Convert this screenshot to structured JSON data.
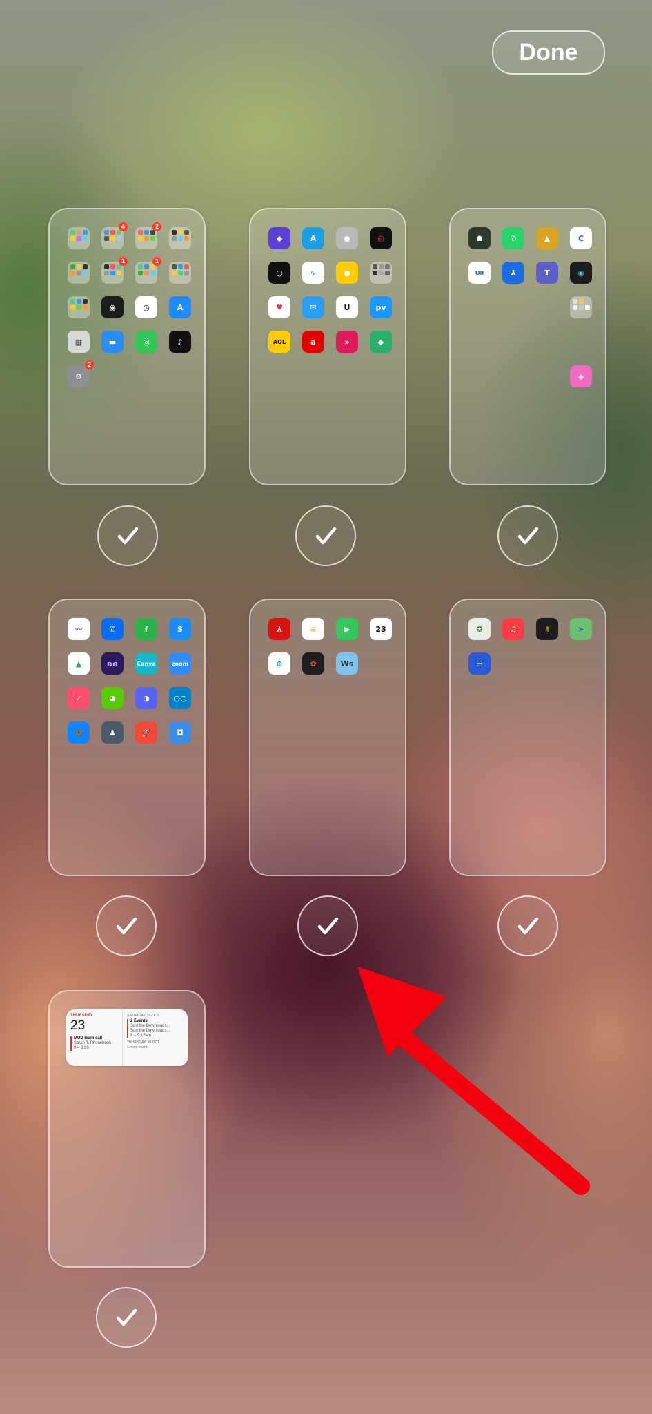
{
  "done_label": "Done",
  "colors": {
    "badge": "#ff3b30",
    "arrow": "#f5010e",
    "check": "#ffffff"
  },
  "pages": [
    {
      "name": "page-1",
      "selected": true,
      "icons": [
        {
          "name": "folder-1",
          "kind": "folder",
          "colors": [
            "#5c8",
            "#f93",
            "#39f",
            "#fc3",
            "#c6f",
            "#6cf"
          ]
        },
        {
          "name": "folder-2",
          "kind": "folder",
          "badge": "4",
          "colors": [
            "#39f",
            "#f55",
            "#6c6",
            "#555",
            "#fc3",
            "#9cf"
          ]
        },
        {
          "name": "folder-3",
          "kind": "folder",
          "badge": "2",
          "colors": [
            "#f66",
            "#39f",
            "#444",
            "#fc3",
            "#f93",
            "#6c6"
          ]
        },
        {
          "name": "folder-4",
          "kind": "folder",
          "colors": [
            "#333",
            "#fc3",
            "#555",
            "#999",
            "#6cf",
            "#f93"
          ]
        },
        {
          "name": "folder-5",
          "kind": "folder",
          "colors": [
            "#4a4",
            "#fc3",
            "#333",
            "#f93",
            "#999",
            "#6cf"
          ]
        },
        {
          "name": "folder-6",
          "kind": "folder",
          "badge": "1",
          "colors": [
            "#333",
            "#f55",
            "#5c8",
            "#999",
            "#39f",
            "#fc3"
          ]
        },
        {
          "name": "folder-7",
          "kind": "folder",
          "badge": "1",
          "colors": [
            "#5c8",
            "#39f",
            "#fc3",
            "#4a4",
            "#f93",
            "#6cf"
          ]
        },
        {
          "name": "folder-8",
          "kind": "folder",
          "colors": [
            "#555",
            "#39f",
            "#f55",
            "#fc3",
            "#5c8",
            "#999"
          ]
        },
        {
          "name": "folder-9",
          "kind": "folder",
          "colors": [
            "#5c8",
            "#39f",
            "#333",
            "#fc3",
            "#6c6",
            "#f93"
          ]
        },
        {
          "name": "watch-app",
          "kind": "app",
          "bg": "#1c1c1e",
          "glyph": "◉"
        },
        {
          "name": "clock-app",
          "kind": "app",
          "bg": "#ffffff",
          "fg": "#111",
          "glyph": "◷"
        },
        {
          "name": "app-store-app",
          "kind": "app",
          "bg": "#1d8cf8",
          "glyph": "A"
        },
        {
          "name": "calculator-app",
          "kind": "app",
          "bg": "#d8d8d8",
          "fg": "#333",
          "glyph": "▦"
        },
        {
          "name": "files-app",
          "kind": "app",
          "bg": "#2a8df5",
          "glyph": "▬"
        },
        {
          "name": "find-my-app",
          "kind": "app",
          "bg": "#33c759",
          "glyph": "◎"
        },
        {
          "name": "tiktok-app",
          "kind": "app",
          "bg": "#111111",
          "glyph": "♪"
        },
        {
          "name": "settings-app",
          "kind": "app",
          "bg": "#8e8e93",
          "glyph": "⚙",
          "badge": "2"
        }
      ]
    },
    {
      "name": "page-2",
      "selected": true,
      "icons": [
        {
          "name": "shortcuts-app",
          "kind": "app",
          "bg": "#5b3fd6",
          "glyph": "◆"
        },
        {
          "name": "translate-app",
          "kind": "app",
          "bg": "#1a9ee8",
          "glyph": "A"
        },
        {
          "name": "contacts-app",
          "kind": "app",
          "bg": "#b8b8b8",
          "glyph": "●"
        },
        {
          "name": "fitness-app",
          "kind": "app",
          "bg": "#111111",
          "fg": "#f33",
          "glyph": "◎"
        },
        {
          "name": "watch-faces-app",
          "kind": "app",
          "bg": "#111111",
          "glyph": "○"
        },
        {
          "name": "freeform-app",
          "kind": "app",
          "bg": "#ffffff",
          "fg": "#2a9df4",
          "glyph": "∿"
        },
        {
          "name": "tips-app",
          "kind": "app",
          "bg": "#ffcc00",
          "glyph": "●"
        },
        {
          "name": "utilities-folder",
          "kind": "folder",
          "colors": [
            "#555",
            "#999",
            "#777",
            "#333",
            "#aaa",
            "#666"
          ]
        },
        {
          "name": "health-app",
          "kind": "app",
          "bg": "#ffffff",
          "fg": "#ff2d55",
          "glyph": "♥"
        },
        {
          "name": "mail-app",
          "kind": "app",
          "bg": "#2a9df4",
          "glyph": "✉"
        },
        {
          "name": "udemy-app",
          "kind": "app",
          "bg": "#ffffff",
          "fg": "#111",
          "glyph": "U"
        },
        {
          "name": "prime-video-app",
          "kind": "app",
          "bg": "#1a98ff",
          "glyph": "pv"
        },
        {
          "name": "aol-app",
          "kind": "app",
          "bg": "#ffcc00",
          "fg": "#111",
          "glyph": "AOL"
        },
        {
          "name": "airtel-app",
          "kind": "app",
          "bg": "#e40000",
          "glyph": "a"
        },
        {
          "name": "kinemaster-app",
          "kind": "app",
          "bg": "#e0195a",
          "glyph": "»"
        },
        {
          "name": "feedly-app",
          "kind": "app",
          "bg": "#27b16b",
          "glyph": "◆"
        }
      ]
    },
    {
      "name": "page-3",
      "selected": true,
      "icons": [
        {
          "name": "game-app",
          "kind": "app",
          "bg": "#2b3a2a",
          "glyph": "☗"
        },
        {
          "name": "whatsapp-app",
          "kind": "app",
          "bg": "#25d366",
          "glyph": "✆"
        },
        {
          "name": "puzzle-game-app",
          "kind": "app",
          "bg": "#d9a520",
          "glyph": "▲"
        },
        {
          "name": "cc-app",
          "kind": "app",
          "bg": "#ffffff",
          "fg": "#1a6de0",
          "glyph": "C"
        },
        {
          "name": "otter-app",
          "kind": "app",
          "bg": "#ffffff",
          "fg": "#1a6de0",
          "glyph": "Oll"
        },
        {
          "name": "acrobat-app",
          "kind": "app",
          "bg": "#1a6de0",
          "glyph": "⅄"
        },
        {
          "name": "teams-app",
          "kind": "app",
          "bg": "#5b5fc7",
          "glyph": "T"
        },
        {
          "name": "eye-app",
          "kind": "app",
          "bg": "#1c1c1e",
          "fg": "#4cd",
          "glyph": "◉"
        },
        {
          "kind": "empty"
        },
        {
          "kind": "empty"
        },
        {
          "kind": "empty"
        },
        {
          "name": "folder-p3",
          "kind": "folder",
          "colors": [
            "#ddd",
            "#fc3",
            "#bbb",
            "#eee",
            "#ccc",
            "#fff"
          ]
        },
        {
          "kind": "empty"
        },
        {
          "kind": "empty"
        },
        {
          "kind": "empty"
        },
        {
          "kind": "empty"
        },
        {
          "kind": "empty"
        },
        {
          "kind": "empty"
        },
        {
          "kind": "empty"
        },
        {
          "name": "layers-app",
          "kind": "app",
          "bg": "#f06ac3",
          "glyph": "◈"
        }
      ]
    },
    {
      "name": "page-4",
      "selected": true,
      "icons": [
        {
          "name": "wave-app",
          "kind": "app",
          "bg": "#ffffff",
          "fg": "#7b5cf5",
          "glyph": "〰"
        },
        {
          "name": "truecaller-app",
          "kind": "app",
          "bg": "#0a6cf5",
          "glyph": "✆"
        },
        {
          "name": "feedly-green-app",
          "kind": "app",
          "bg": "#2bb24c",
          "glyph": "f"
        },
        {
          "name": "shazam-app",
          "kind": "app",
          "bg": "#1a8cf8",
          "glyph": "S"
        },
        {
          "name": "google-drive-app",
          "kind": "app",
          "bg": "#ffffff",
          "fg": "#1fa463",
          "glyph": "▲"
        },
        {
          "name": "butterfly-app",
          "kind": "app",
          "bg": "#2d1b5e",
          "fg": "#c9a6ff",
          "glyph": "ʚɞ"
        },
        {
          "name": "canva-app",
          "kind": "app",
          "bg": "#16b5c7",
          "glyph": "Canva"
        },
        {
          "name": "zoom-app",
          "kind": "app",
          "bg": "#2d8cff",
          "glyph": "zoom"
        },
        {
          "name": "tick-app",
          "kind": "app",
          "bg": "#ff4d6d",
          "glyph": "✓"
        },
        {
          "name": "duolingo-app",
          "kind": "app",
          "bg": "#58cc02",
          "glyph": "◕"
        },
        {
          "name": "discord-app",
          "kind": "app",
          "bg": "#5865f2",
          "glyph": "◑"
        },
        {
          "name": "nextcloud-app",
          "kind": "app",
          "bg": "#0082c9",
          "glyph": "○○"
        },
        {
          "name": "bluesky-app",
          "kind": "app",
          "bg": "#1185fe",
          "glyph": "🦋"
        },
        {
          "name": "pubg-app",
          "kind": "app",
          "bg": "#4a5a6a",
          "glyph": "♟"
        },
        {
          "name": "rocket-app",
          "kind": "app",
          "bg": "#f24a3a",
          "glyph": "🚀"
        },
        {
          "name": "robot-app",
          "kind": "app",
          "bg": "#3a8ee8",
          "glyph": "◘"
        }
      ]
    },
    {
      "name": "page-5",
      "selected": true,
      "icons": [
        {
          "name": "adobe-reader-app",
          "kind": "app",
          "bg": "#d7140f",
          "glyph": "⅄"
        },
        {
          "name": "notes-app",
          "kind": "app",
          "bg": "#ffffff",
          "fg": "#f5c400",
          "glyph": "≡"
        },
        {
          "name": "facetime-app",
          "kind": "app",
          "bg": "#34c759",
          "glyph": "▶"
        },
        {
          "name": "calendar-app",
          "kind": "app",
          "bg": "#ffffff",
          "fg": "#111",
          "glyph": "23",
          "top": "Thu"
        },
        {
          "name": "safari-app",
          "kind": "app",
          "bg": "#ffffff",
          "fg": "#1a8cf8",
          "glyph": "⊕"
        },
        {
          "name": "figma-app",
          "kind": "app",
          "bg": "#1e1e1e",
          "fg": "#f24e1e",
          "glyph": "✿"
        },
        {
          "name": "word-game-app",
          "kind": "app",
          "bg": "#7cc3f0",
          "fg": "#333",
          "glyph": "Ws"
        }
      ]
    },
    {
      "name": "page-6",
      "selected": true,
      "icons": [
        {
          "name": "kerala-app",
          "kind": "app",
          "bg": "#e9eee4",
          "fg": "#2a7a3a",
          "glyph": "✪"
        },
        {
          "name": "music-app",
          "kind": "app",
          "bg": "#fc3c44",
          "glyph": "♫"
        },
        {
          "name": "keys-app",
          "kind": "app",
          "bg": "#1c1c1e",
          "fg": "#f5c400",
          "glyph": "⚷"
        },
        {
          "name": "maps-app",
          "kind": "app",
          "bg": "#6cc070",
          "fg": "#1a6de0",
          "glyph": "➤"
        },
        {
          "name": "lines-app",
          "kind": "app",
          "bg": "#2a5bd7",
          "glyph": "☰"
        }
      ]
    },
    {
      "name": "page-7",
      "selected": true,
      "widget": {
        "day": "THURSDAY",
        "date": "23",
        "event_title": "MUD team call",
        "event_sub": "Sarah T. Phonebook",
        "event_time": "9 – 9:30",
        "right_date": "SATURDAY, 25 OCT",
        "right_count": "2 Events",
        "right_l1": "Sort the Downloads...",
        "right_l2": "Sort the Downloads...",
        "right_l3": "9 – 9:15am",
        "right_date2": "THURSDAY, 30 OCT",
        "right_l4": "1 more event"
      }
    }
  ]
}
